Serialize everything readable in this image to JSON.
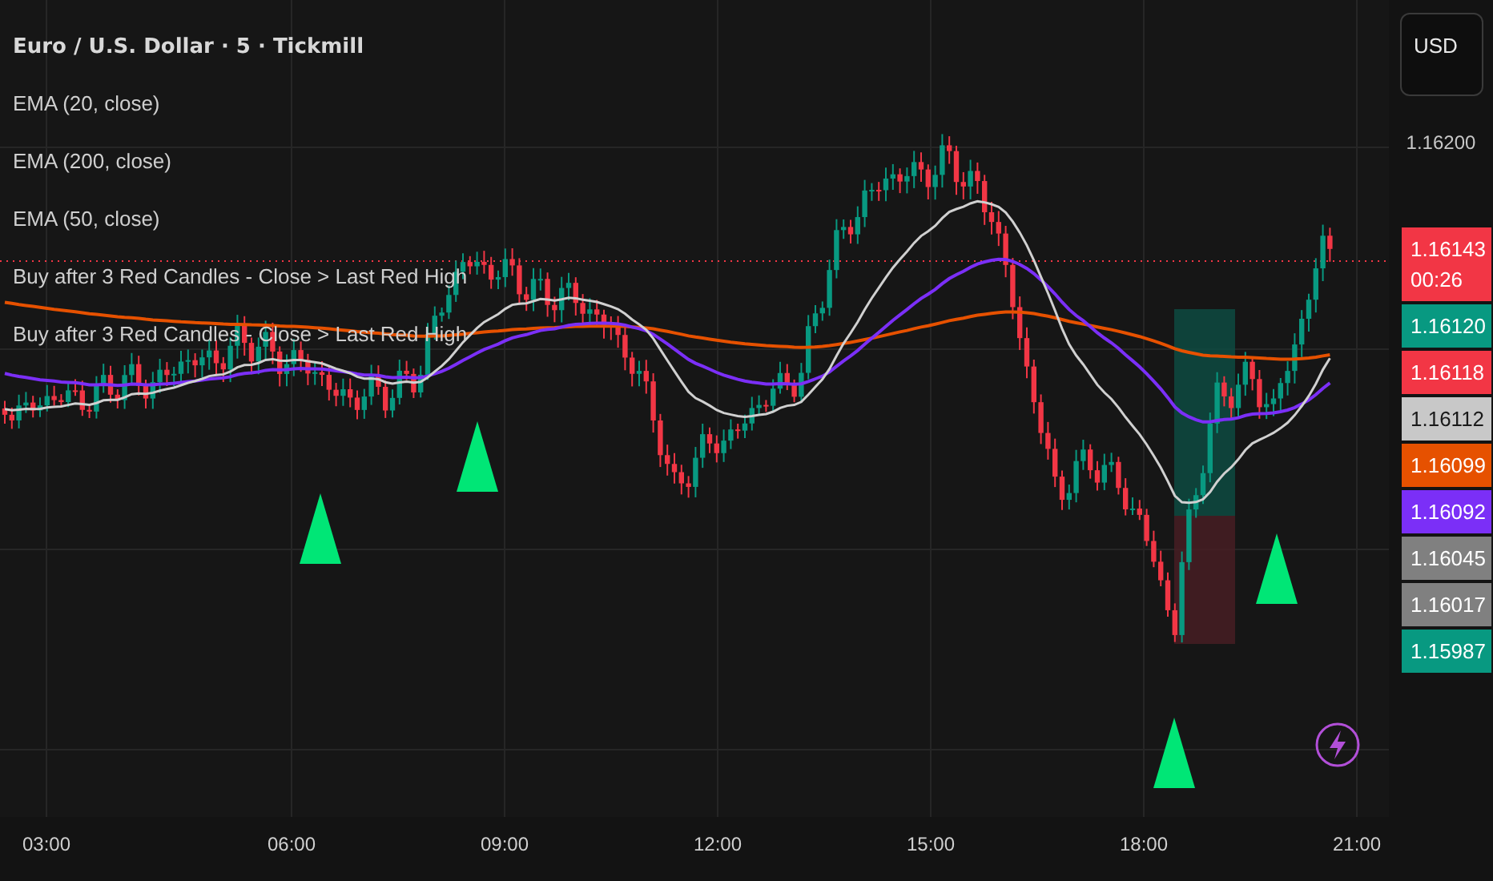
{
  "legend": {
    "title": "Euro / U.S. Dollar · 5 · Tickmill",
    "indicators": [
      "EMA (20, close)",
      "EMA (200, close)",
      "EMA (50, close)",
      "Buy after 3 Red Candles - Close > Last Red High",
      "Buy after 3 Red Candles - Close > Last Red High"
    ]
  },
  "currency_button": "USD",
  "price_axis": {
    "tick": "1.16200",
    "labels": [
      {
        "price": "1.16143",
        "countdown": "00:26",
        "color": "#f23645"
      },
      {
        "price": "1.16120",
        "color": "#089981"
      },
      {
        "price": "1.16118",
        "color": "#f23645"
      },
      {
        "price": "1.16112",
        "color": "#c8c8c8"
      },
      {
        "price": "1.16099",
        "color": "#e65100"
      },
      {
        "price": "1.16092",
        "color": "#7b2ff7"
      },
      {
        "price": "1.16045",
        "color": "#808080"
      },
      {
        "price": "1.16017",
        "color": "#808080"
      },
      {
        "price": "1.15987",
        "color": "#089981"
      }
    ]
  },
  "time_axis": [
    "03:00",
    "06:00",
    "09:00",
    "12:00",
    "15:00",
    "18:00",
    "21:00"
  ]
}
